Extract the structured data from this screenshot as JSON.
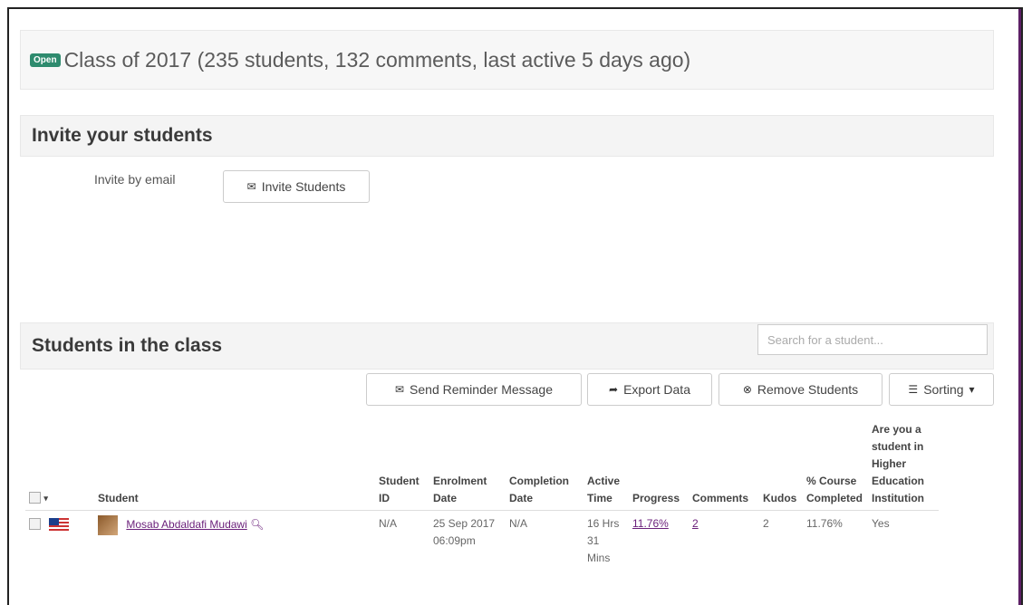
{
  "class_header": {
    "badge": "Open",
    "title": "Class of 2017 (235 students, 132 comments, last active 5 days ago)"
  },
  "invite": {
    "heading": "Invite your students",
    "label": "Invite by email",
    "button_icon": "envelope-icon",
    "button_label": "Invite Students"
  },
  "students_section": {
    "heading": "Students in the class",
    "search_placeholder": "Search for a student...",
    "actions": {
      "send_reminder": "Send Reminder Message",
      "export_data": "Export Data",
      "remove_students": "Remove Students",
      "sorting": "Sorting"
    }
  },
  "table": {
    "headers": {
      "student": "Student",
      "student_id": "Student ID",
      "enrolment_date": "Enrolment Date",
      "completion_date": "Completion Date",
      "active_time": "Active Time",
      "progress": "Progress",
      "comments": "Comments",
      "kudos": "Kudos",
      "course_completed": "% Course Completed",
      "higher_ed": "Are you a student in Higher Education Institution"
    },
    "rows": [
      {
        "name": "Mosab Abdaldafi Mudawi",
        "student_id": "N/A",
        "enrolment_date": "25 Sep 2017 06:09pm",
        "completion_date": "N/A",
        "active_time": "16 Hrs 31 Mins",
        "progress": "11.76%",
        "comments": "2",
        "kudos": "2",
        "course_completed": "11.76%",
        "higher_ed": "Yes"
      }
    ]
  },
  "colors": {
    "badge": "#2e8b6e",
    "link": "#6a1f7a",
    "panel_bg": "#f4f4f4"
  }
}
